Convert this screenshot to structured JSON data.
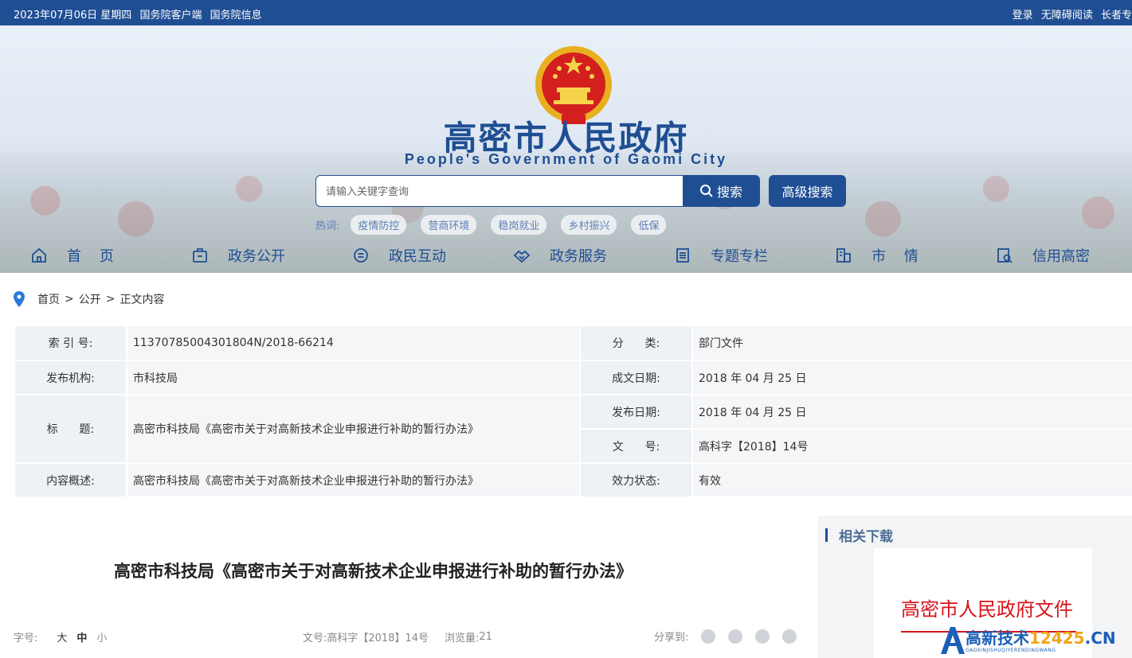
{
  "topbar": {
    "date": "2023年07月06日 星期四",
    "link_client": "国务院客户端",
    "link_info": "国务院信息",
    "login": "登录",
    "accessible": "无障碍阅读",
    "elder": "长者专"
  },
  "header": {
    "title": "高密市人民政府",
    "subtitle": "People's Government of Gaomi City"
  },
  "search": {
    "placeholder": "请输入关键字查询",
    "button": "搜索",
    "advanced": "高级搜索"
  },
  "hot": {
    "label": "热词:",
    "tags": [
      "疫情防控",
      "营商环境",
      "稳岗就业",
      "乡村振兴",
      "低保"
    ]
  },
  "nav": [
    {
      "label": "首    页",
      "icon": "home-icon"
    },
    {
      "label": "政务公开",
      "icon": "briefcase-icon"
    },
    {
      "label": "政民互动",
      "icon": "chat-icon"
    },
    {
      "label": "政务服务",
      "icon": "handshake-icon"
    },
    {
      "label": "专题专栏",
      "icon": "document-icon"
    },
    {
      "label": "市    情",
      "icon": "building-icon"
    },
    {
      "label": "信用高密",
      "icon": "credit-search-icon"
    }
  ],
  "breadcrumb": {
    "home": "首页",
    "public": "公开",
    "current": "正文内容",
    "sep": ">"
  },
  "info": {
    "index_label": "索 引 号:",
    "index_value": "11370785004301804N/2018-66214",
    "category_label": "分      类:",
    "category_value": "部门文件",
    "issuer_label": "发布机构:",
    "issuer_value": "市科技局",
    "created_label": "成文日期:",
    "created_value": "2018 年 04 月 25 日",
    "title_label": "标      题:",
    "title_value": "高密市科技局《高密市关于对高新技术企业申报进行补助的暂行办法》",
    "published_label": "发布日期:",
    "published_value": "2018 年 04 月 25 日",
    "docno_label": "文      号:",
    "docno_value": "高科字【2018】14号",
    "summary_label": "内容概述:",
    "summary_value": "高密市科技局《高密市关于对高新技术企业申报进行补助的暂行办法》",
    "status_label": "效力状态:",
    "status_value": "有效"
  },
  "article": {
    "title": "高密市科技局《高密市关于对高新技术企业申报进行补助的暂行办法》",
    "font_label": "字号:",
    "font_large": "大",
    "font_medium": "中",
    "font_small": "小",
    "docno": "文号:高科字【2018】14号",
    "views_label": "浏览量:",
    "views": "21",
    "share_label": "分享到:"
  },
  "sidebar": {
    "title": "相关下载",
    "doc_header": "高密市人民政府文件"
  },
  "watermark": {
    "brand": "高新技术",
    "num": "12425",
    "tld": ".CN",
    "sub": "GAOXINJISHUQIYERENDINGWANG"
  },
  "colors": {
    "brand_blue": "#1f4e93",
    "doc_red": "#d9141b"
  }
}
